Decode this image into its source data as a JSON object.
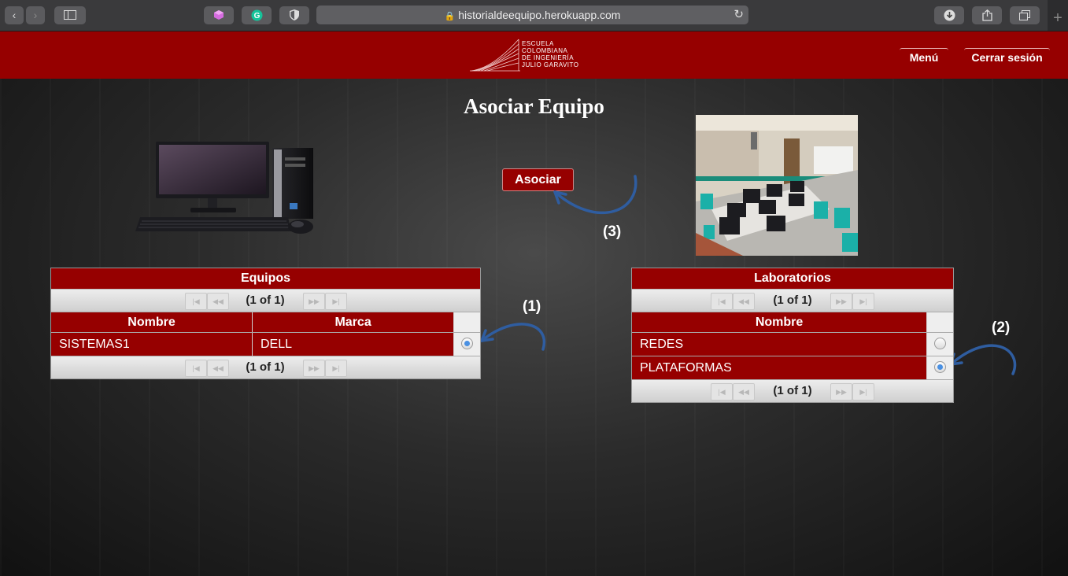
{
  "browser": {
    "url": "historialdeequipo.herokuapp.com"
  },
  "header": {
    "logo_lines": [
      "ESCUELA",
      "COLOMBIANA",
      "DE INGENIERÍA",
      "JULIO GARAVITO"
    ],
    "menu_label": "Menú",
    "logout_label": "Cerrar sesión"
  },
  "page": {
    "title": "Asociar Equipo",
    "associate_button": "Asociar",
    "annotations": [
      "(1)",
      "(2)",
      "(3)"
    ]
  },
  "equipos": {
    "title": "Equipos",
    "pager": "(1 of 1)",
    "columns": [
      "Nombre",
      "Marca"
    ],
    "rows": [
      {
        "nombre": "SISTEMAS1",
        "marca": "DELL",
        "selected": true
      }
    ]
  },
  "laboratorios": {
    "title": "Laboratorios",
    "pager": "(1 of 1)",
    "columns": [
      "Nombre"
    ],
    "rows": [
      {
        "nombre": "REDES",
        "selected": false
      },
      {
        "nombre": "PLATAFORMAS",
        "selected": true
      }
    ]
  },
  "colors": {
    "brand_red": "#960000",
    "annotation_arrow": "#2f5da0",
    "radio_selected": "#4a90e2"
  }
}
